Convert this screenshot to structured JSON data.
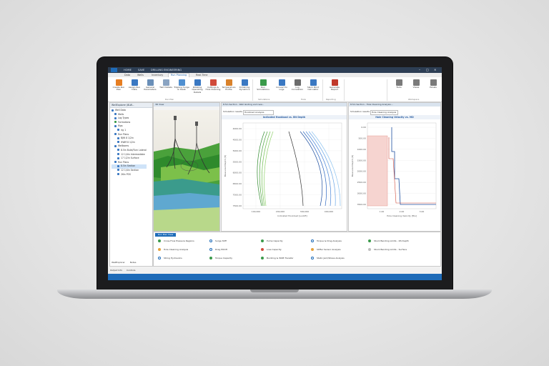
{
  "app": {
    "menu": [
      "HOME",
      "SAVE",
      "DRILLING ENGINEERING"
    ],
    "tabs": [
      "Data",
      "Wells",
      "Inventory",
      "Run Planning",
      "Real-Time"
    ],
    "active_tab": "Run Planning"
  },
  "ribbon": {
    "buttons": [
      {
        "label": "Create Run Plan",
        "color": "#e67e22"
      },
      {
        "label": "Assign Run Data",
        "color": "#3a78c2"
      },
      {
        "label": "General Parameters",
        "color": "#6a8fb8"
      },
      {
        "label": "T&D Details",
        "color": "#8aa4c2"
      },
      {
        "label": "Tripping Surge & Swab",
        "color": "#4f8fd0"
      },
      {
        "label": "Rotating Operating Details",
        "color": "#3a78c2"
      },
      {
        "label": "Cuttings & Hole Cleaning",
        "color": "#d04a3a"
      },
      {
        "label": "Temperature Profile",
        "color": "#d9822b"
      },
      {
        "label": "Drillstring Dynamics",
        "color": "#3a78c2"
      },
      {
        "label": "Run Simulations",
        "color": "#3a9a4a"
      },
      {
        "label": "Convert to Logs",
        "color": "#3a78c2"
      },
      {
        "label": "Log Correlation",
        "color": "#6b6b6b"
      },
      {
        "label": "Slack Point Calculator",
        "color": "#3a78c2"
      },
      {
        "label": "Generate Report",
        "color": "#c0392b"
      },
      {
        "label": "Tools",
        "color": "#7a7a7a"
      },
      {
        "label": "Views",
        "color": "#7a7a7a"
      },
      {
        "label": "Panels",
        "color": "#7a7a7a"
      }
    ],
    "groups": [
      "Run Plan",
      "Simulations",
      "Tools",
      "Reporting",
      "Workspace"
    ]
  },
  "explorer": {
    "title": "WellExplorer (8LW...",
    "items": [
      {
        "label": "Well Data",
        "color": "#3a78c2"
      },
      {
        "label": "Wells",
        "color": "#3a78c2"
      },
      {
        "label": "Log Types",
        "color": "#3a78c2"
      },
      {
        "label": "Formations",
        "color": "#3a9a4a"
      },
      {
        "label": "Rigs",
        "color": "#3a78c2"
      },
      {
        "label": "rig 1",
        "color": "#3a78c2"
      },
      {
        "label": "Run Plans",
        "color": "#3a78c2"
      },
      {
        "label": "BJW 8 1/2in",
        "color": "#3a78c2"
      },
      {
        "label": "HWM 8 1/2in",
        "color": "#3a78c2"
      },
      {
        "label": "Wellbores",
        "color": "#3a78c2"
      },
      {
        "label": "8.5in Build/Turn Lateral",
        "color": "#3a78c2"
      },
      {
        "label": "12 1/4in Intermediate",
        "color": "#3a78c2"
      },
      {
        "label": "17 1/2in Surface",
        "color": "#3a78c2"
      },
      {
        "label": "Run Plans",
        "color": "#3a78c2"
      },
      {
        "label": "8.5in Section",
        "color": "#3a78c2",
        "selected": true
      },
      {
        "label": "12 1/4in Section",
        "color": "#3a78c2"
      },
      {
        "label": "26in POS",
        "color": "#3a78c2"
      }
    ],
    "footer": [
      "WellExplorer",
      "Notes"
    ]
  },
  "view3d": {
    "tab": "3D View"
  },
  "chart_panel1": {
    "tab": "8.5in Section - Well landing and new...",
    "sim_label": "Simulation results",
    "select": "Hookload Analysis",
    "chart_data": {
      "type": "line",
      "title": "Indicated Hookload vs. Bit Depth",
      "xlabel": "Indicated Hookload [usdcft]",
      "ylabel": "Measured Depth [ft]",
      "xticks": [
        "100,000",
        "200,000",
        "300,000",
        "400,000"
      ],
      "yticks": [
        "4000.00",
        "4500.00",
        "5000.00",
        "5500.00",
        "6000.00",
        "6500.00",
        "7000.00",
        "7500.00"
      ]
    }
  },
  "chart_panel2": {
    "tab": "8.5in Section - Hole Cleaning Analysis...",
    "sim_label": "Simulation results",
    "select": "Hole Cleaning Analysis",
    "chart_data": {
      "type": "line",
      "title": "Hole Cleaning Velocity vs. MD",
      "xlabel": "Hole Cleaning Velocity [ft/s]",
      "ylabel": "Measured Depth [ft]",
      "xticks": [
        "1.00",
        "2.00",
        "3.00"
      ],
      "yticks": [
        "0.00",
        "500.00",
        "1000.00",
        "1500.00",
        "2000.00",
        "2500.00",
        "3000.00",
        "3500.00"
      ]
    }
  },
  "run_panel": {
    "tab": "Run Plan View",
    "items": [
      {
        "label": "Cross-Flow Pressure Regions",
        "status": "#3a9a4a"
      },
      {
        "label": "Surge Stiff",
        "status": "none"
      },
      {
        "label": "Pump Capacity",
        "status": "#3a9a4a"
      },
      {
        "label": "Torque & Drag Analysis",
        "status": "none"
      },
      {
        "label": "Stuck Bending Limits - RS Depth",
        "status": "#3a9a4a"
      },
      {
        "label": "Hole Cleaning Analysis",
        "status": "#e6a23c"
      },
      {
        "label": "Drag POOH",
        "status": "none"
      },
      {
        "label": "Loss Capacity",
        "status": "#d04a3a"
      },
      {
        "label": "Stiffer Sensor Analysis",
        "status": "#e6a23c"
      },
      {
        "label": "Stuck Bending Limits - Surface",
        "status": "#bdbdbd"
      },
      {
        "label": "String Hydraulics",
        "status": "none"
      },
      {
        "label": "Torque Capacity",
        "status": "#3a9a4a"
      },
      {
        "label": "Buckling & WOB Transfer",
        "status": "#3a9a4a"
      },
      {
        "label": "Static Jam/Stress Analysis",
        "status": "none"
      }
    ]
  },
  "bottom_tabs": [
    "Output Info",
    "Controls"
  ]
}
